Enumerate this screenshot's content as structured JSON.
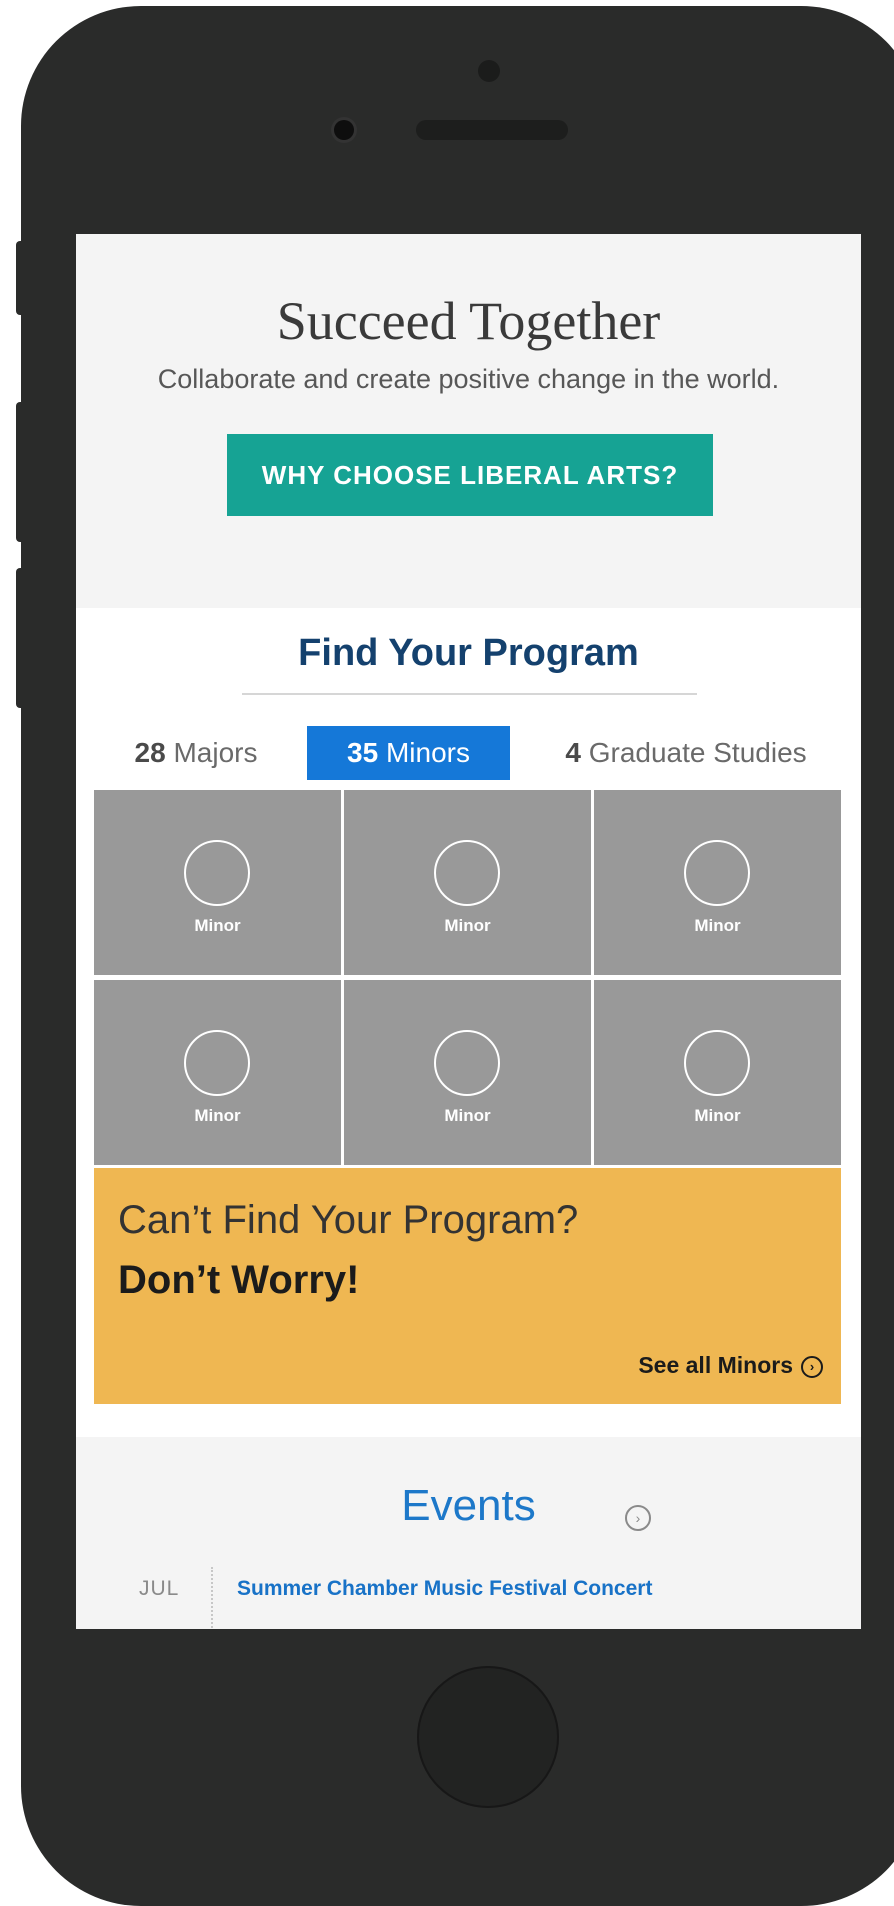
{
  "hero": {
    "title": "Succeed Together",
    "subtitle": "Collaborate and create positive change in the world.",
    "cta_label": "WHY CHOOSE LIBERAL ARTS?"
  },
  "program": {
    "title": "Find Your Program",
    "tabs": [
      {
        "count": "28",
        "label": "Majors",
        "selected": false
      },
      {
        "count": "35",
        "label": "Minors",
        "selected": true
      },
      {
        "count": "4",
        "label": "Graduate Studies",
        "selected": false
      }
    ],
    "tiles": [
      {
        "label": "Minor"
      },
      {
        "label": "Minor"
      },
      {
        "label": "Minor"
      },
      {
        "label": "Minor"
      },
      {
        "label": "Minor"
      },
      {
        "label": "Minor"
      }
    ]
  },
  "promo": {
    "question": "Can’t Find Your Program?",
    "answer": "Don’t Worry!",
    "link_label": "See all Minors",
    "link_icon": "chevron-right-circle-icon"
  },
  "events": {
    "title": "Events",
    "more_icon": "chevron-right-circle-icon",
    "items": [
      {
        "month": "JUL",
        "title": "Summer Chamber Music Festival Concert"
      }
    ]
  },
  "colors": {
    "teal": "#16a394",
    "blue": "#1578d8",
    "navy": "#14416e",
    "gold": "#efb752",
    "frame": "#2a2b2a"
  }
}
